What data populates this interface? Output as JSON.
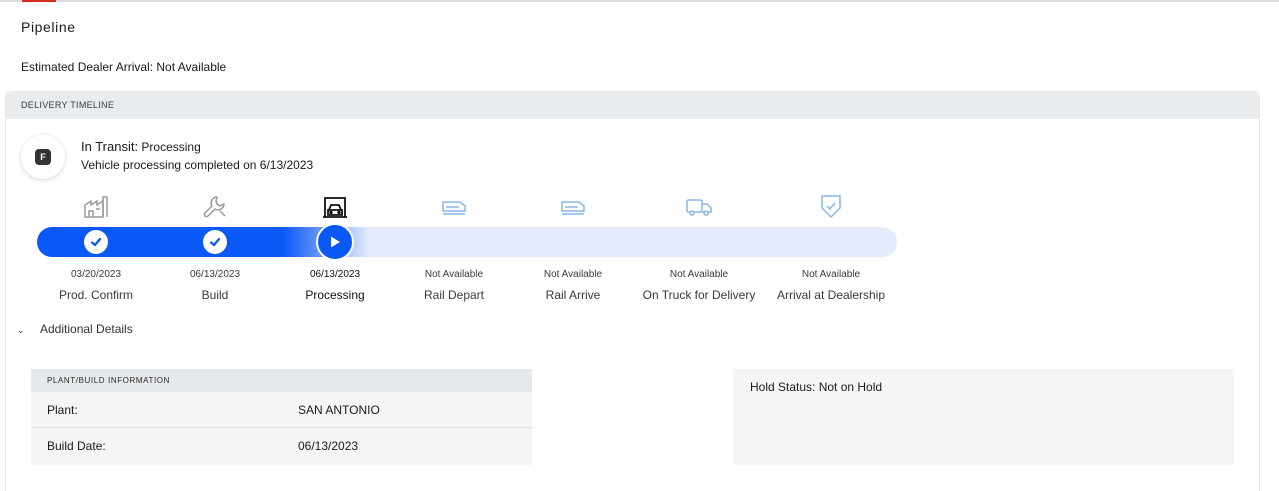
{
  "page": {
    "title": "Pipeline",
    "arrival_text": "Estimated Dealer Arrival: Not Available"
  },
  "timeline": {
    "header": "DELIVERY TIMELINE",
    "badge_letter": "F",
    "status_label": "In Transit:",
    "status_value": "Processing",
    "status_description": "Vehicle processing completed on 6/13/2023",
    "steps": [
      {
        "label": "Prod. Confirm",
        "date": "03/20/2023",
        "icon": "factory-icon",
        "state": "completed"
      },
      {
        "label": "Build",
        "date": "06/13/2023",
        "icon": "wrench-icon",
        "state": "completed"
      },
      {
        "label": "Processing",
        "date": "06/13/2023",
        "icon": "car-garage-icon",
        "state": "current"
      },
      {
        "label": "Rail Depart",
        "date": "Not Available",
        "icon": "rail-car-icon",
        "state": "pending"
      },
      {
        "label": "Rail Arrive",
        "date": "Not Available",
        "icon": "rail-car-icon",
        "state": "pending"
      },
      {
        "label": "On Truck for Delivery",
        "date": "Not Available",
        "icon": "truck-icon",
        "state": "pending"
      },
      {
        "label": "Arrival at Dealership",
        "date": "Not Available",
        "icon": "shield-check-icon",
        "state": "pending"
      }
    ],
    "colors": {
      "progress": "#0a58f5",
      "track": "#e4ebfb",
      "pending_icon": "#8ab6e8",
      "done_icon": "#9a9a9a"
    }
  },
  "details": {
    "toggle_label": "Additional Details",
    "plant_header": "PLANT/BUILD INFORMATION",
    "rows": [
      {
        "key": "Plant:",
        "value": "SAN ANTONIO"
      },
      {
        "key": "Build Date:",
        "value": "06/13/2023"
      }
    ],
    "hold_status": "Hold Status: Not on Hold"
  }
}
